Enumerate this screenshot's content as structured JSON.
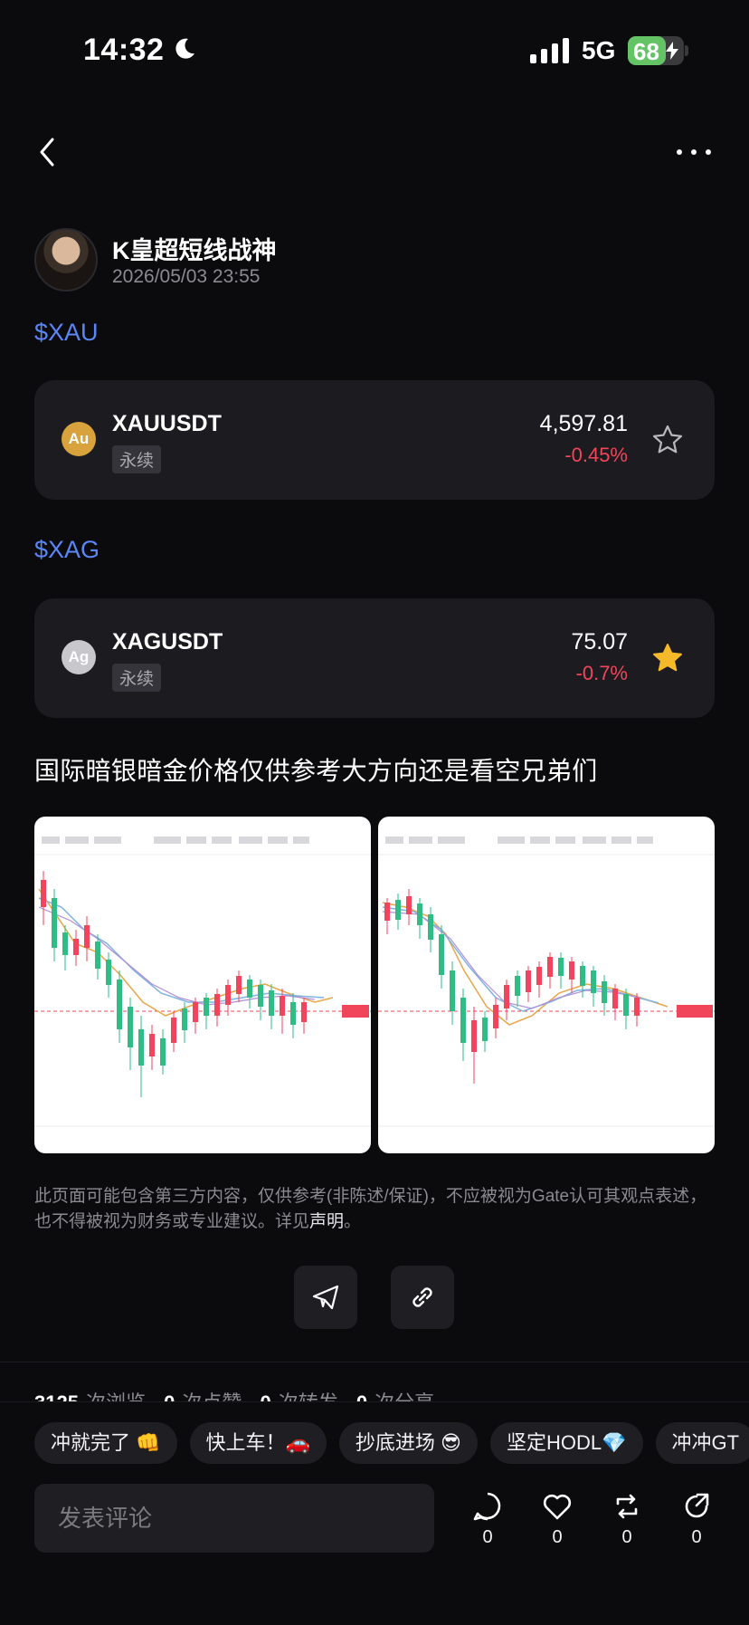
{
  "status_bar": {
    "time": "14:32",
    "network": "5G",
    "battery": "68"
  },
  "post": {
    "author": "K皇超短线战神",
    "time": "2026/05/03 23:55",
    "text": "国际暗银暗金价格仅供参考大方向还是看空兄弟们"
  },
  "assets": [
    {
      "tag": "$XAU",
      "icon_text": "Au",
      "symbol": "XAUUSDT",
      "type": "永续",
      "price": "4,597.81",
      "change": "-0.45%",
      "starred": false
    },
    {
      "tag": "$XAG",
      "icon_text": "Ag",
      "symbol": "XAGUSDT",
      "type": "永续",
      "price": "75.07",
      "change": "-0.7%",
      "starred": true
    }
  ],
  "disclaimer": {
    "text": "此页面可能包含第三方内容，仅供参考(非陈述/保证)，不应被视为Gate认可其观点表述，也不得被视为财务或专业建议。详见",
    "link": "声明",
    "end": "。"
  },
  "stats": {
    "views": "3125",
    "views_label": "次浏览",
    "likes": "0",
    "likes_label": "次点赞",
    "reposts": "0",
    "reposts_label": "次转发",
    "shares": "0",
    "shares_label": "次分享"
  },
  "quick_replies": [
    "冲就完了 👊",
    "快上车！🚗",
    "抄底进场 😎",
    "坚定HODL💎",
    "冲冲GT"
  ],
  "comment": {
    "placeholder": "发表评论"
  },
  "actions": {
    "comment_count": "0",
    "like_count": "0",
    "repost_count": "0",
    "share_count": "0"
  },
  "colors": {
    "accent": "#5b86f5",
    "down": "#f0455a",
    "star": "#f5b92a",
    "card": "#1c1c20"
  }
}
